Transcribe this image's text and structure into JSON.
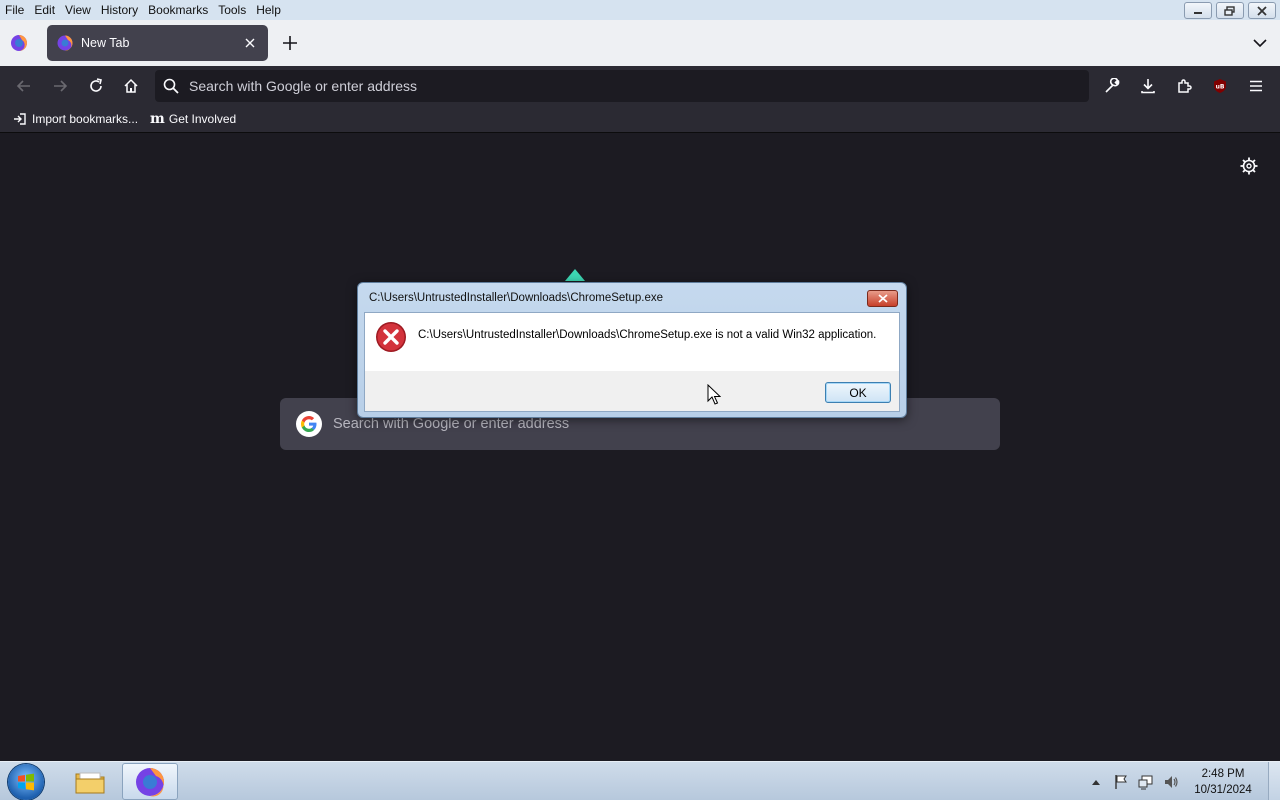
{
  "menubar": {
    "items": [
      "File",
      "Edit",
      "View",
      "History",
      "Bookmarks",
      "Tools",
      "Help"
    ]
  },
  "tabs": {
    "active_title": "New Tab"
  },
  "toolbar": {
    "url_placeholder": "Search with Google or enter address"
  },
  "bookmarks": {
    "import_label": "Import bookmarks...",
    "get_involved_label": "Get Involved"
  },
  "newtab": {
    "search_placeholder": "Search with Google or enter address"
  },
  "dialog": {
    "title": "C:\\Users\\UntrustedInstaller\\Downloads\\ChromeSetup.exe",
    "message": "C:\\Users\\UntrustedInstaller\\Downloads\\ChromeSetup.exe is not a valid Win32 application.",
    "ok_label": "OK"
  },
  "taskbar": {
    "time": "2:48 PM",
    "date": "10/31/2024"
  },
  "colors": {
    "content_bg": "#1c1b22",
    "toolbar_bg": "#2b2a33",
    "error_red": "#c4262e",
    "accent_teal": "#3dd8b4"
  },
  "icons": [
    "firefox-icon",
    "close-icon",
    "plus-icon",
    "chevron-down-icon",
    "back-arrow-icon",
    "forward-arrow-icon",
    "reload-icon",
    "home-icon",
    "search-icon",
    "wrench-icon",
    "download-icon",
    "extensions-icon",
    "ublock-icon",
    "hamburger-menu-icon",
    "import-icon",
    "gear-icon",
    "google-icon",
    "error-icon",
    "windows-start-icon",
    "folder-icon",
    "flag-icon",
    "network-icon",
    "speaker-icon"
  ]
}
